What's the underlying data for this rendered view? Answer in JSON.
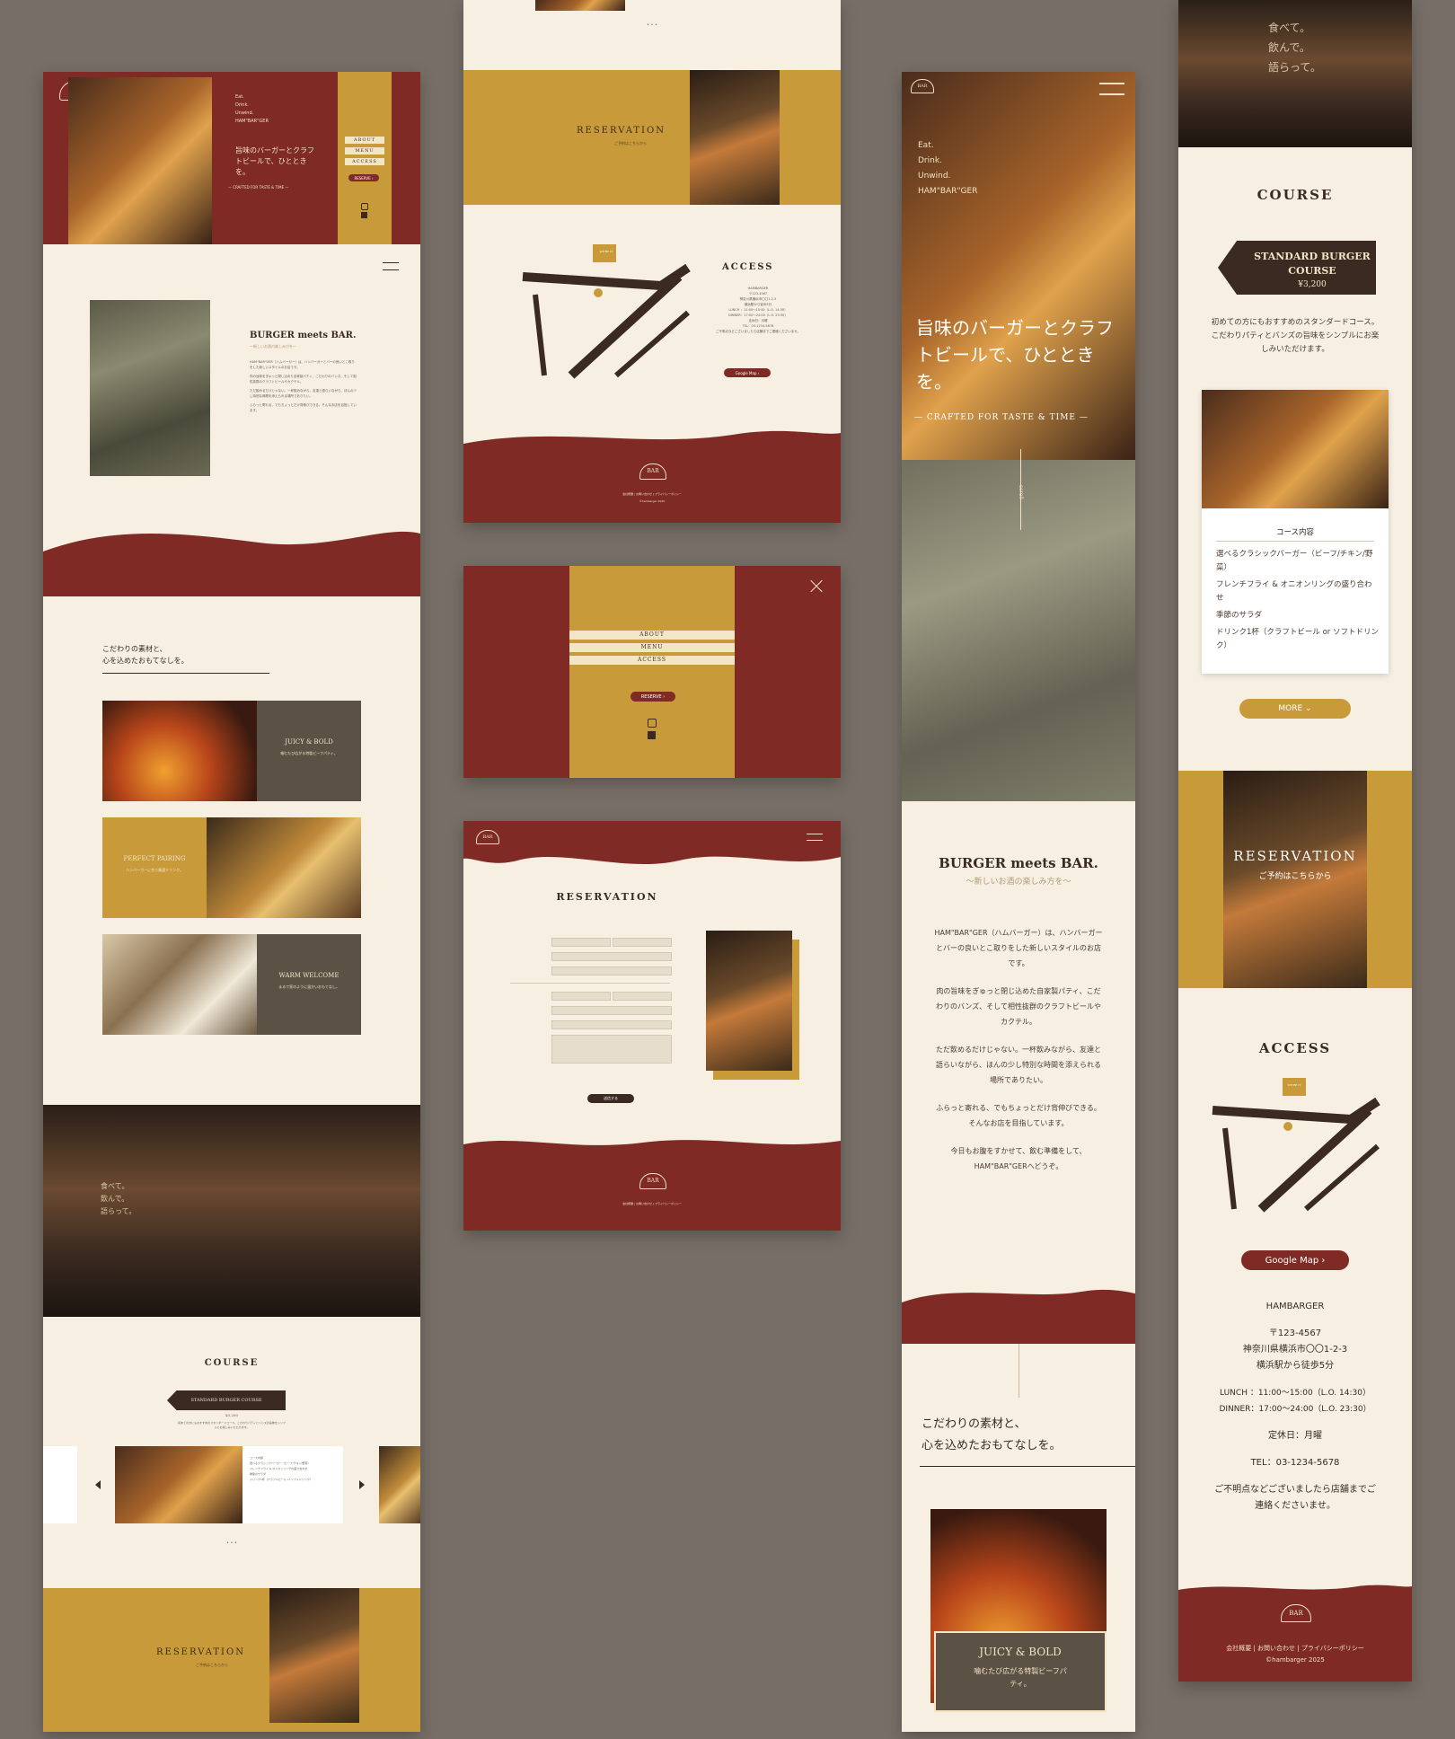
{
  "brand": {
    "logo_text": "BAR"
  },
  "hero": {
    "tagline_lines": [
      "Eat.",
      "Drink.",
      "Unwind.",
      "HAM\"BAR\"GER"
    ],
    "headline": "旨味のバーガーとクラフトビールで、ひとときを。",
    "subline": "— CRAFTED FOR TASTE & TIME —",
    "scroll": "scroll"
  },
  "nav": {
    "items": [
      "ABOUT",
      "MENU",
      "ACCESS"
    ],
    "reserve": "RESERVE ›"
  },
  "about": {
    "title": "BURGER meets BAR.",
    "subtitle": "〜新しいお酒の楽しみ方を〜",
    "paragraphs": [
      "HAM\"BAR\"GER（ハムバーガー）は、ハンバーガーとバーの良いとこ取りをした新しいスタイルのお店です。",
      "肉の旨味をぎゅっと閉じ込めた自家製パティ、こだわりのバンズ、そして相性抜群のクラフトビールやカクテル。",
      "ただ飲めるだけじゃない。一杯飲みながら、友達と語らいながら、ほんの少し特別な時間を添えられる場所でありたい。",
      "ふらっと寄れる、でもちょっとだけ背伸びできる。そんなお店を目指しています。",
      "今日もお腹をすかせて、飲む準備をして、HAM\"BAR\"GERへどうぞ。"
    ]
  },
  "features": {
    "heading_line1": "こだわりの素材と、",
    "heading_line2": "心を込めたおもてなしを。",
    "cards": [
      {
        "title": "JUICY & BOLD",
        "text": "噛むたび広がる特製ビーフパティ。"
      },
      {
        "title": "PERFECT PAIRING",
        "text": "ハンバーガーに合う厳選ドリンク。"
      },
      {
        "title": "WARM WELCOME",
        "text": "まるで家のように温かいおもてなし。"
      }
    ]
  },
  "bar_image_text": [
    "食べて。",
    "飲んで。",
    "語らって。"
  ],
  "course": {
    "title": "COURSE",
    "name": "STANDARD BURGER COURSE",
    "price": "¥3,200",
    "intro": "初めての方にもおすすめのスタンダードコース。こだわりパティとバンズの旨味をシンプルにお楽しみいただけます。",
    "contents_label": "コース内容",
    "items": [
      "選べるクラシックバーガー（ビーフ/チキン/野菜）",
      "フレンチフライ & オニオンリングの盛り合わせ",
      "季節のサラダ",
      "ドリンク1杯（クラフトビール or ソフトドリンク）"
    ],
    "more": "MORE ⌄",
    "dots": "• • •"
  },
  "reservation": {
    "title": "RESERVATION",
    "sub": "ご予約はこちらから"
  },
  "access": {
    "title": "ACCESS",
    "name": "HAMBARGER",
    "postal": "〒123-4567",
    "address": "神奈川県横浜市〇〇1-2-3",
    "station": "横浜駅から徒歩5分",
    "lunch": "LUNCH ：11:00〜15:00（L.O. 14:30）",
    "dinner": "DINNER：17:00〜24:00（L.O. 23:30）",
    "holiday": "定休日：月曜",
    "tel": "TEL：03-1234-5678",
    "note": "ご不明点などございましたら店舗までご連絡くださいませ。",
    "map_button": "Google Map ›",
    "map_pin": "WE'RE IT",
    "map_label": "HAMBARGER"
  },
  "footer": {
    "links": "会社概要 | お問い合わせ | プライバシーポリシー",
    "copyright": "©hambarger 2025"
  },
  "form": {
    "submit": "送信する"
  },
  "colors": {
    "maroon": "#7f2a25",
    "gold": "#c99a3a",
    "cream": "#f6efe2",
    "brown": "#5c5145",
    "background": "#776f67"
  }
}
